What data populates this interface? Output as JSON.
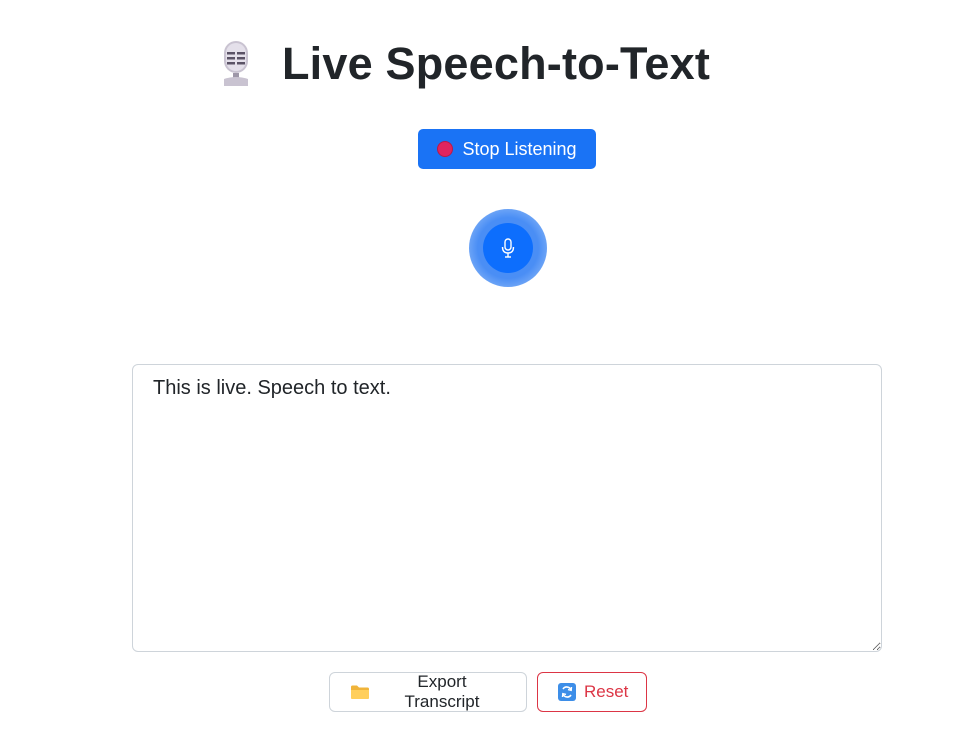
{
  "header": {
    "title": "Live Speech-to-Text",
    "icon": "studio-microphone-emoji"
  },
  "controls": {
    "stop_label": "Stop Listening",
    "stop_icon": "record-icon"
  },
  "indicator": {
    "state": "listening",
    "icon": "microphone-icon",
    "color": "#0d6efd"
  },
  "transcript": {
    "value": "This is live. Speech to text."
  },
  "actions": {
    "export_label": "Export Transcript",
    "export_icon": "folder-icon",
    "reset_label": "Reset",
    "reset_icon": "refresh-icon"
  },
  "colors": {
    "primary": "#1a73f5",
    "danger": "#dc3545",
    "record": "#e0245e"
  }
}
